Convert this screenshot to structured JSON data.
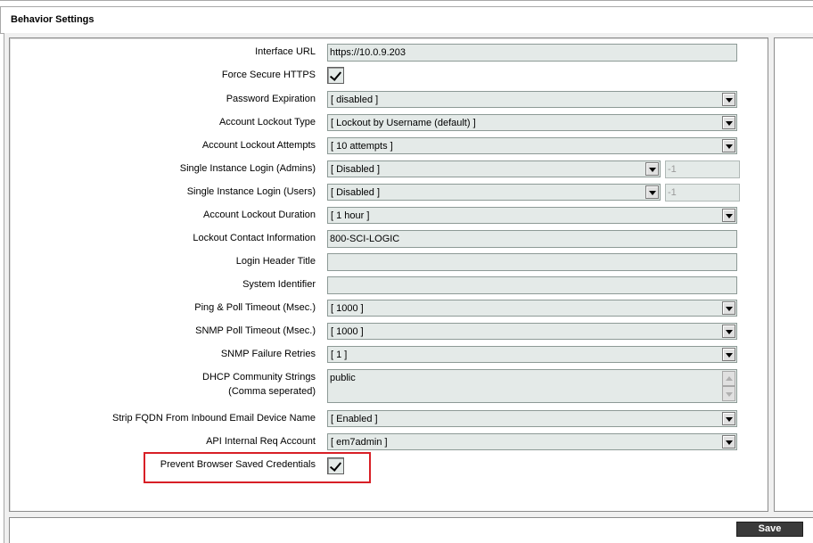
{
  "page": {
    "title": "Behavior Settings"
  },
  "fields": {
    "interface_url": {
      "label": "Interface URL",
      "value": "https://10.0.9.203"
    },
    "force_secure_https": {
      "label": "Force Secure HTTPS",
      "checked": true
    },
    "password_expiration": {
      "label": "Password Expiration",
      "value": "[ disabled ]"
    },
    "account_lockout_type": {
      "label": "Account Lockout Type",
      "value": "[ Lockout by Username (default) ]"
    },
    "account_lockout_attempts": {
      "label": "Account Lockout Attempts",
      "value": "[ 10 attempts ]"
    },
    "single_instance_admins": {
      "label": "Single Instance Login (Admins)",
      "value": "[ Disabled ]",
      "extra": "-1"
    },
    "single_instance_users": {
      "label": "Single Instance Login (Users)",
      "value": "[ Disabled ]",
      "extra": "-1"
    },
    "account_lockout_duration": {
      "label": "Account Lockout Duration",
      "value": "[ 1 hour ]"
    },
    "lockout_contact_info": {
      "label": "Lockout Contact Information",
      "value": "800-SCI-LOGIC"
    },
    "login_header_title": {
      "label": "Login Header Title",
      "value": ""
    },
    "system_identifier": {
      "label": "System Identifier",
      "value": ""
    },
    "ping_poll_timeout": {
      "label": "Ping & Poll Timeout (Msec.)",
      "value": "[ 1000 ]"
    },
    "snmp_poll_timeout": {
      "label": "SNMP Poll Timeout (Msec.)",
      "value": "[ 1000 ]"
    },
    "snmp_failure_retries": {
      "label": "SNMP Failure Retries",
      "value": "[ 1 ]"
    },
    "dhcp_community_strings": {
      "label_line1": "DHCP Community Strings",
      "label_line2": "(Comma seperated)",
      "value": "public"
    },
    "strip_fqdn": {
      "label": "Strip FQDN From Inbound Email Device Name",
      "value": "[ Enabled ]"
    },
    "api_internal_req_account": {
      "label": "API Internal Req Account",
      "value": "[ em7admin ]"
    },
    "prevent_browser_saved_credentials": {
      "label": "Prevent Browser Saved Credentials",
      "checked": true
    }
  },
  "footer": {
    "save_label": "Save"
  },
  "colors": {
    "highlight": "#d81f26",
    "field_bg": "#e4eae8",
    "save_bg": "#3a3a3a"
  }
}
